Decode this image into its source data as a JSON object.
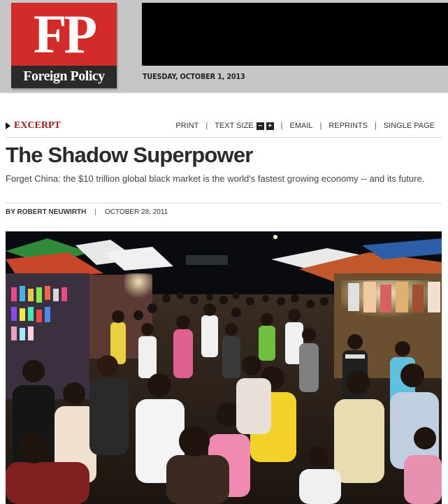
{
  "masthead": {
    "logo_mark": "FP",
    "logo_name": "Foreign Policy",
    "date": "TUESDAY, OCTOBER 1, 2013"
  },
  "toolbar": {
    "section": "EXCERPT",
    "print": "PRINT",
    "text_size": "TEXT SIZE",
    "size_down": "−",
    "size_up": "+",
    "email": "EMAIL",
    "reprints": "REPRINTS",
    "single_page": "SINGLE PAGE"
  },
  "article": {
    "title": "The Shadow Superpower",
    "dek": "Forget China: the $10 trillion global black market is the world's fastest growing economy -- and its future.",
    "byline": "BY ROBERT NEUWIRTH",
    "date": "OCTOBER 28, 2011"
  },
  "colors": {
    "brand_red": "#d32a2a",
    "section_red": "#9b1b1b",
    "masthead_gray": "#c6c6c6"
  }
}
